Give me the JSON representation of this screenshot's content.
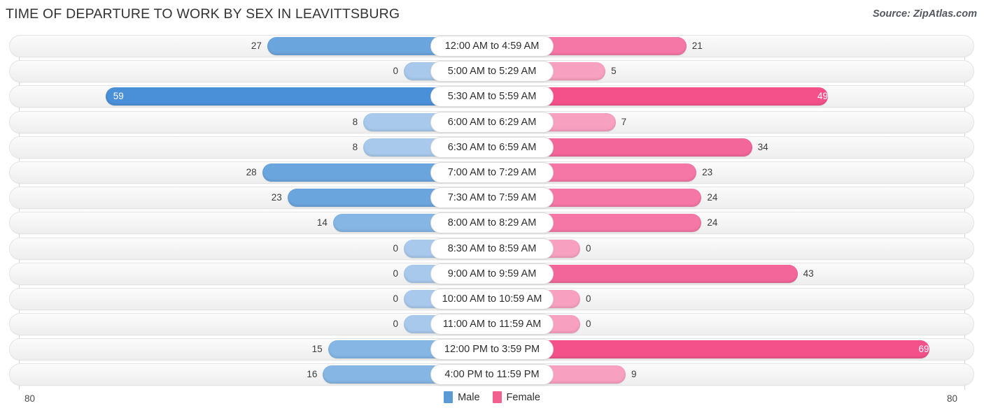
{
  "header": {
    "title": "TIME OF DEPARTURE TO WORK BY SEX IN LEAVITTSBURG",
    "source": "Source: ZipAtlas.com"
  },
  "legend": {
    "male_label": "Male",
    "female_label": "Female",
    "male_color": "#5b9bd5",
    "female_color": "#f2608f"
  },
  "axis": {
    "left_label": "80",
    "right_label": "80",
    "max": 80
  },
  "chart_data": {
    "type": "bar",
    "orientation": "horizontal-diverging",
    "title": "TIME OF DEPARTURE TO WORK BY SEX IN LEAVITTSBURG",
    "xlabel": "",
    "ylabel": "",
    "xlim": [
      80,
      80
    ],
    "grid": false,
    "legend_position": "bottom-center",
    "categories": [
      "12:00 AM to 4:59 AM",
      "5:00 AM to 5:29 AM",
      "5:30 AM to 5:59 AM",
      "6:00 AM to 6:29 AM",
      "6:30 AM to 6:59 AM",
      "7:00 AM to 7:29 AM",
      "7:30 AM to 7:59 AM",
      "8:00 AM to 8:29 AM",
      "8:30 AM to 8:59 AM",
      "9:00 AM to 9:59 AM",
      "10:00 AM to 10:59 AM",
      "11:00 AM to 11:59 AM",
      "12:00 PM to 3:59 PM",
      "4:00 PM to 11:59 PM"
    ],
    "series": [
      {
        "name": "Male",
        "color": "#5b9bd5",
        "values": [
          27,
          0,
          59,
          8,
          8,
          28,
          23,
          14,
          0,
          0,
          0,
          0,
          15,
          16
        ]
      },
      {
        "name": "Female",
        "color": "#f2608f",
        "values": [
          21,
          5,
          49,
          7,
          34,
          23,
          24,
          24,
          0,
          43,
          0,
          0,
          69,
          9
        ]
      }
    ]
  },
  "rows": [
    {
      "category": "12:00 AM to 4:59 AM",
      "male": 27,
      "female": 21,
      "male_text": "27",
      "female_text": "21"
    },
    {
      "category": "5:00 AM to 5:29 AM",
      "male": 0,
      "female": 5,
      "male_text": "0",
      "female_text": "5"
    },
    {
      "category": "5:30 AM to 5:59 AM",
      "male": 59,
      "female": 49,
      "male_text": "59",
      "female_text": "49"
    },
    {
      "category": "6:00 AM to 6:29 AM",
      "male": 8,
      "female": 7,
      "male_text": "8",
      "female_text": "7"
    },
    {
      "category": "6:30 AM to 6:59 AM",
      "male": 8,
      "female": 34,
      "male_text": "8",
      "female_text": "34"
    },
    {
      "category": "7:00 AM to 7:29 AM",
      "male": 28,
      "female": 23,
      "male_text": "28",
      "female_text": "23"
    },
    {
      "category": "7:30 AM to 7:59 AM",
      "male": 23,
      "female": 24,
      "male_text": "23",
      "female_text": "24"
    },
    {
      "category": "8:00 AM to 8:29 AM",
      "male": 14,
      "female": 24,
      "male_text": "14",
      "female_text": "24"
    },
    {
      "category": "8:30 AM to 8:59 AM",
      "male": 0,
      "female": 0,
      "male_text": "0",
      "female_text": "0"
    },
    {
      "category": "9:00 AM to 9:59 AM",
      "male": 0,
      "female": 43,
      "male_text": "0",
      "female_text": "43"
    },
    {
      "category": "10:00 AM to 10:59 AM",
      "male": 0,
      "female": 0,
      "male_text": "0",
      "female_text": "0"
    },
    {
      "category": "11:00 AM to 11:59 AM",
      "male": 0,
      "female": 0,
      "male_text": "0",
      "female_text": "0"
    },
    {
      "category": "12:00 PM to 3:59 PM",
      "male": 15,
      "female": 69,
      "male_text": "15",
      "female_text": "69"
    },
    {
      "category": "4:00 PM to 11:59 PM",
      "male": 16,
      "female": 9,
      "male_text": "16",
      "female_text": "9"
    }
  ]
}
